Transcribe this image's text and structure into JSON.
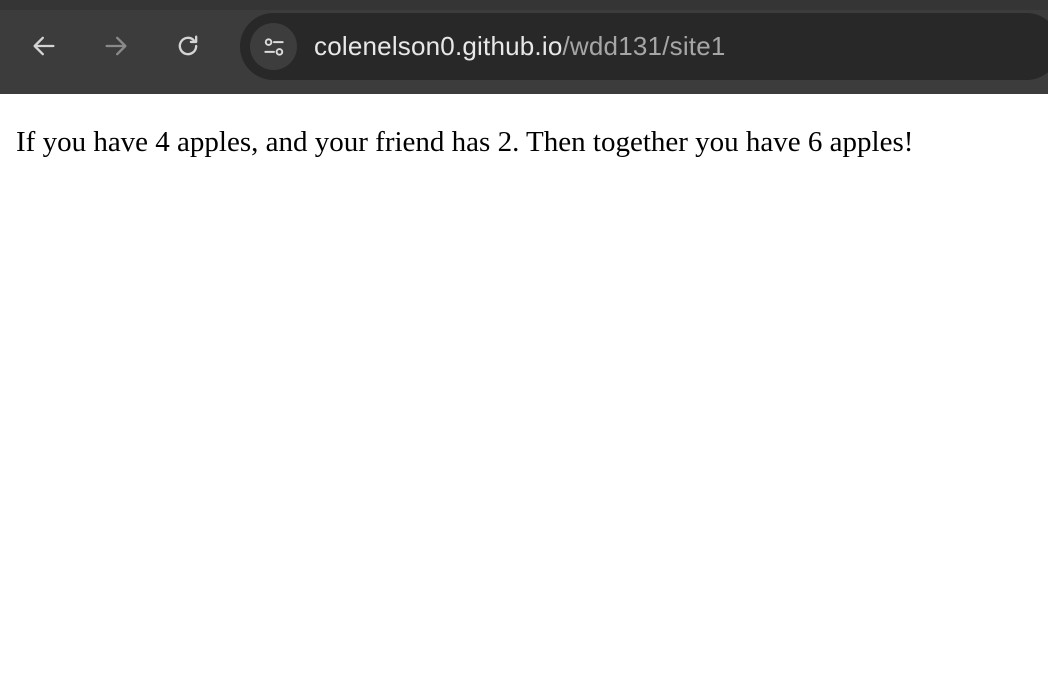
{
  "browser": {
    "address_bar": {
      "host": "colenelson0.github.io",
      "path": "/wdd131/site1"
    },
    "buttons": {
      "back_icon": "arrow-left",
      "forward_icon": "arrow-right",
      "reload_icon": "reload",
      "site_info_icon": "tune"
    },
    "colors": {
      "toolbar_bg": "#3c3c3c",
      "omnibox_bg": "#282828",
      "url_text": "#e8e8e8",
      "url_path_text": "#a6a6a6"
    }
  },
  "page": {
    "text": "If you have 4 apples, and your friend has 2. Then together you have 6 apples!"
  }
}
